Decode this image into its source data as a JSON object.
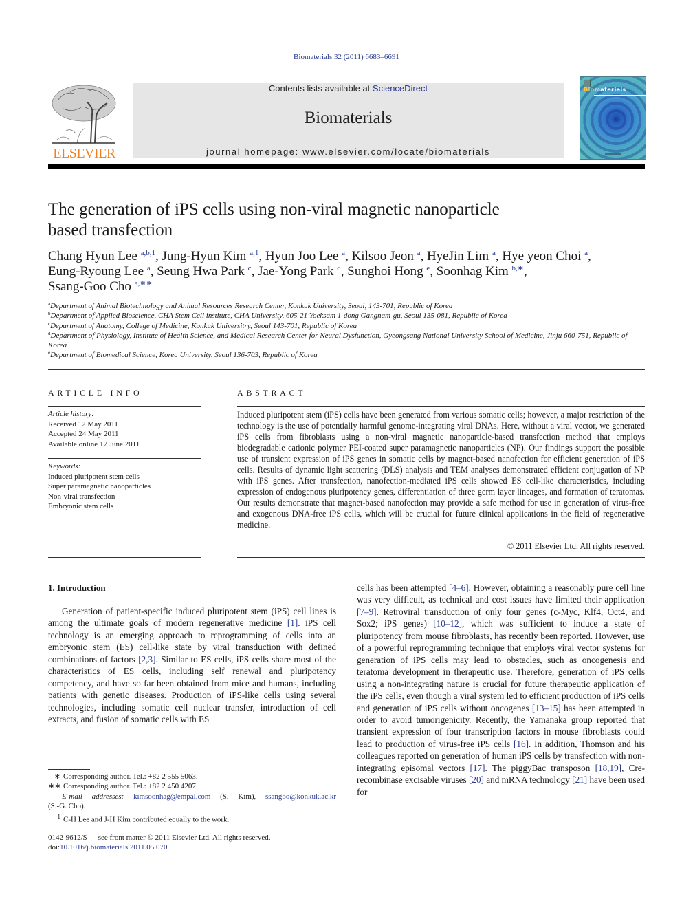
{
  "journal_citation": "Biomaterials 32 (2011) 6683–6691",
  "header": {
    "publisher_logo_text": "ELSEVIER",
    "contents_prefix": "Contents lists available at ",
    "contents_link": "ScienceDirect",
    "journal_name": "Biomaterials",
    "homepage": "journal homepage: www.elsevier.com/locate/biomaterials",
    "cover": {
      "title_accent": "Bio",
      "title_rest": "materials"
    },
    "colors": {
      "elsevier_orange": "#f07f1a",
      "link_blue": "#2b3a8f",
      "banner_gray": "#e6e6e6"
    }
  },
  "article": {
    "title_line1": "The generation of iPS cells using non-viral magnetic nanoparticle",
    "title_line2": "based transfection",
    "authors": [
      {
        "name": "Chang Hyun Lee",
        "sup": "a,b,1",
        "sep": ", "
      },
      {
        "name": "Jung-Hyun Kim",
        "sup": "a,1",
        "sep": ", "
      },
      {
        "name": "Hyun Joo Lee",
        "sup": "a",
        "sep": ", "
      },
      {
        "name": "Kilsoo Jeon",
        "sup": "a",
        "sep": ", "
      },
      {
        "name": "HyeJin Lim",
        "sup": "a",
        "sep": ", "
      },
      {
        "name": "Hye yeon Choi",
        "sup": "a",
        "sep": ","
      },
      {
        "name": "Eung-Ryoung Lee",
        "sup": "a",
        "sep": ", "
      },
      {
        "name": "Seung Hwa Park",
        "sup": "c",
        "sep": ", "
      },
      {
        "name": "Jae-Yong Park",
        "sup": "d",
        "sep": ", "
      },
      {
        "name": "Sunghoi Hong",
        "sup": "e",
        "sep": ", "
      },
      {
        "name": "Soonhag Kim",
        "sup": "b,∗",
        "sep": ","
      },
      {
        "name": "Ssang-Goo Cho",
        "sup": "a,∗∗",
        "sep": ""
      }
    ],
    "affiliations": [
      {
        "mark": "a",
        "text": "Department of Animal Biotechnology and Animal Resources Research Center, Konkuk University, Seoul, 143-701, Republic of Korea"
      },
      {
        "mark": "b",
        "text": "Department of Applied Bioscience, CHA Stem Cell institute, CHA University, 605-21 Yoeksam 1-dong Gangnam-gu, Seoul 135-081, Republic of Korea"
      },
      {
        "mark": "c",
        "text": "Department of Anatomy, College of Medicine, Konkuk Universitry, Seoul 143-701, Republic of Korea"
      },
      {
        "mark": "d",
        "text": "Department of Physiology, Institute of Health Science, and Medical Research Center for Neural Dysfunction, Gyeongsang National University School of Medicine, Jinju 660-751, Republic of Korea"
      },
      {
        "mark": "e",
        "text": "Department of Biomedical Science, Korea University, Seoul 136-703, Republic of Korea"
      }
    ]
  },
  "article_info": {
    "heading": "ARTICLE INFO",
    "history_label": "Article history:",
    "received": "Received 12 May 2011",
    "accepted": "Accepted 24 May 2011",
    "online": "Available online 17 June 2011",
    "keywords_label": "Keywords:",
    "keywords": [
      "Induced pluripotent stem cells",
      "Super paramagnetic nanoparticles",
      "Non-viral transfection",
      "Embryonic stem cells"
    ]
  },
  "abstract": {
    "heading": "ABSTRACT",
    "text": "Induced pluripotent stem (iPS) cells have been generated from various somatic cells; however, a major restriction of the technology is the use of potentially harmful genome-integrating viral DNAs. Here, without a viral vector, we generated iPS cells from fibroblasts using a non-viral magnetic nanoparticle-based transfection method that employs biodegradable cationic polymer PEI-coated super paramagnetic nanoparticles (NP). Our findings support the possible use of transient expression of iPS genes in somatic cells by magnet-based nanofection for efficient generation of iPS cells. Results of dynamic light scattering (DLS) analysis and TEM analyses demonstrated efficient conjugation of NP with iPS genes. After trans­fection, nanofection-mediated iPS cells showed ES cell-like characteristics, including expression of endogenous pluripotency genes, differentiation of three germ layer lineages, and formation of teratomas. Our results demonstrate that magnet-based nanofection may provide a safe method for use in generation of virus-free and exogenous DNA-free iPS cells, which will be crucial for future clinical applications in the field of regenerative medicine.",
    "copyright": "© 2011 Elsevier Ltd. All rights reserved."
  },
  "introduction": {
    "heading": "1.  Introduction",
    "left_segments": [
      {
        "t": "Generation of patient-specific induced pluripotent stem (iPS) cell lines is among the ultimate goals of modern regenerative medicine "
      },
      {
        "ref": "[1]"
      },
      {
        "t": ". iPS cell technology is an emerging approach to reprogramming of cells into an embryonic stem (ES) cell-like state by viral transduction with defined combinations of factors "
      },
      {
        "ref": "[2,3]"
      },
      {
        "t": ". Similar to ES cells, iPS cells share most of the characteristics of ES cells, including self renewal and pluripotency competency, and have so far been obtained from mice and humans, including patients with genetic diseases. Production of iPS-like cells using several technologies, including somatic cell nuclear transfer, introduction of cell extracts, and fusion of somatic cells with ES"
      }
    ],
    "right_segments": [
      {
        "t": "cells has been attempted "
      },
      {
        "ref": "[4–6]"
      },
      {
        "t": ". However, obtaining a reasonably pure cell line was very difficult, as technical and cost issues have limited their application "
      },
      {
        "ref": "[7–9]"
      },
      {
        "t": ". Retroviral transduction of only four genes (c-Myc, Klf4, Oct4, and Sox2; iPS genes) "
      },
      {
        "ref": "[10–12]"
      },
      {
        "t": ", which was sufficient to induce a state of pluripotency from mouse fibroblasts, has recently been reported. However, use of a powerful reprog­ramming technique that employs viral vector systems for genera­tion of iPS cells may lead to obstacles, such as oncogenesis and teratoma development in therapeutic use. Therefore, generation of iPS cells using a non-integrating nature is crucial for future thera­peutic application of the iPS cells, even though a viral system led to efficient production of iPS cells and generation of iPS cells without oncogenes "
      },
      {
        "ref": "[13–15]"
      },
      {
        "t": " has been attempted in order to avoid tumori­genicity. Recently, the Yamanaka group reported that transient expression of four transcription factors in mouse fibroblasts could lead to production of virus-free iPS cells "
      },
      {
        "ref": "[16]"
      },
      {
        "t": ". In addition, Thomson and his colleagues reported on generation of human iPS cells by transfection with non-integrating episomal vectors "
      },
      {
        "ref": "[17]"
      },
      {
        "t": ". The piggyBac transposon "
      },
      {
        "ref": "[18,19]"
      },
      {
        "t": ", Cre-recombinase excisable viruses "
      },
      {
        "ref": "[20]"
      },
      {
        "t": " and mRNA technology "
      },
      {
        "ref": "[21]"
      },
      {
        "t": " have been used for"
      }
    ]
  },
  "footnotes": {
    "corr1_mark": "∗",
    "corr1_text": "Corresponding author. Tel.: +82 2 555 5063.",
    "corr2_mark": "∗∗",
    "corr2_text": "Corresponding author. Tel.: +82 2 450 4207.",
    "email_label": "E-mail addresses:",
    "email1": "kimsoonhag@empal.com",
    "email1_owner": " (S. Kim), ",
    "email2": "ssangoo@konkuk.ac.kr",
    "email2_owner": "(S.-G. Cho).",
    "note1_mark": "1",
    "note1_text": "C-H Lee and J-H Kim contributed equally to the work."
  },
  "bottom": {
    "issn_line": "0142-9612/$ — see front matter © 2011 Elsevier Ltd. All rights reserved.",
    "doi_prefix": "doi:",
    "doi": "10.1016/j.biomaterials.2011.05.070"
  }
}
